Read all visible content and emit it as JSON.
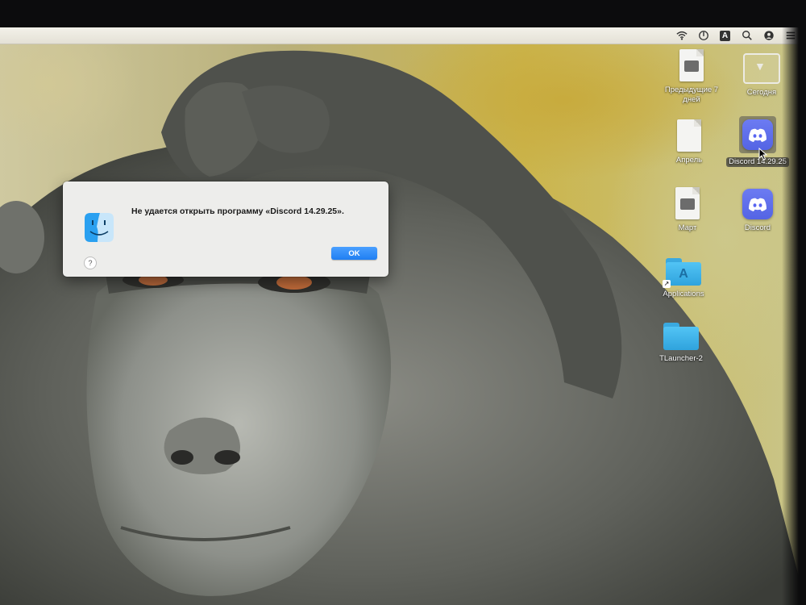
{
  "menubar": {
    "icons": [
      "wifi-icon",
      "power-icon",
      "keyboard-input-icon",
      "search-icon",
      "user-avatar-icon",
      "control-center-icon"
    ],
    "input_letter": "A"
  },
  "desktop": {
    "items": [
      {
        "label": "Предыдущие 7 дней",
        "icon": "document-icon"
      },
      {
        "label": "Сегодня",
        "icon": "folder-icon"
      },
      {
        "label": "Апрель",
        "icon": "document-icon"
      },
      {
        "label": "Discord 14.29.25",
        "icon": "discord-icon",
        "selected": true
      },
      {
        "label": "Март",
        "icon": "document-icon"
      },
      {
        "label": "Discord",
        "icon": "discord-icon"
      },
      {
        "label": "Applications",
        "icon": "applications-folder-icon"
      },
      {
        "label": "TLauncher-2",
        "icon": "folder-icon"
      }
    ]
  },
  "dialog": {
    "message": "Не удается открыть программу «Discord 14.29.25».",
    "ok_label": "OK",
    "help_label": "?"
  },
  "colors": {
    "accent": "#1f7ef2",
    "discord": "#5865f2",
    "folder": "#3eb4ec"
  }
}
